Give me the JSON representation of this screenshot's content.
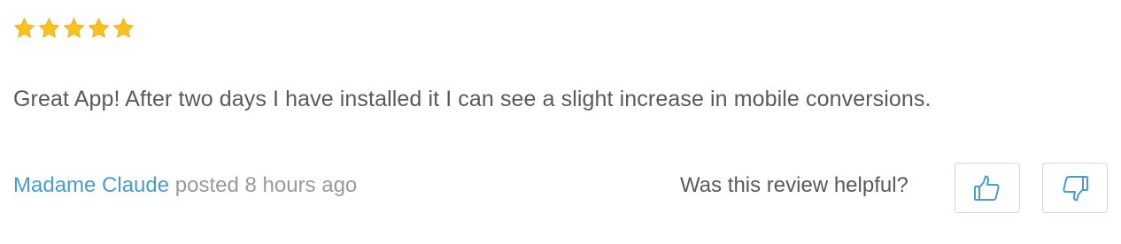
{
  "review": {
    "rating": 5,
    "rating_max": 5,
    "star_color": "#f9c21c",
    "body": "Great App! After two days I have installed it I can see a slight increase in mobile conversions.",
    "author": "Madame Claude",
    "posted": "posted 8 hours ago",
    "author_color": "#4a9ccc"
  },
  "feedback": {
    "question": "Was this review helpful?",
    "upvote_icon": "thumbs-up-icon",
    "downvote_icon": "thumbs-down-icon"
  }
}
